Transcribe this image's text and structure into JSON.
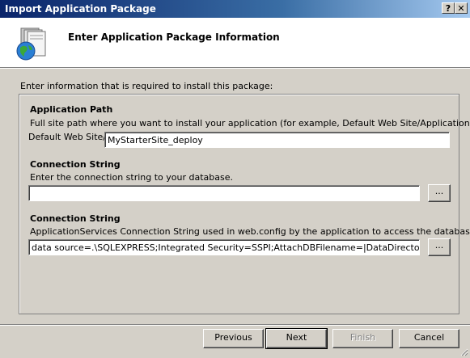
{
  "window": {
    "title": "Import Application Package",
    "help_glyph": "?",
    "close_glyph": "✕"
  },
  "header": {
    "heading": "Enter Application Package Information",
    "icon": "package-globe-icon"
  },
  "intro_text": "Enter information that is required to install this package:",
  "sections": {
    "app_path": {
      "title": "Application Path",
      "description": "Full site path where you want to install your application (for example, Default Web Site/Application).",
      "prefix_label": "Default Web Site/",
      "value": "MyStarterSite_deploy"
    },
    "conn1": {
      "title": "Connection String",
      "description": "Enter the connection string to your database.",
      "value": "",
      "browse_label": "..."
    },
    "conn2": {
      "title": "Connection String",
      "description": "ApplicationServices Connection String used in web.config by the application to access the database.",
      "value": "data source=.\\SQLEXPRESS;Integrated Security=SSPI;AttachDBFilename=|DataDirectory|\\aspnetd",
      "browse_label": "..."
    }
  },
  "footer": {
    "previous_label": "Previous",
    "next_label": "Next",
    "finish_label": "Finish",
    "cancel_label": "Cancel"
  },
  "colors": {
    "title_start": "#0a246a",
    "title_end": "#a6caf0",
    "face": "#d4d0c8"
  }
}
